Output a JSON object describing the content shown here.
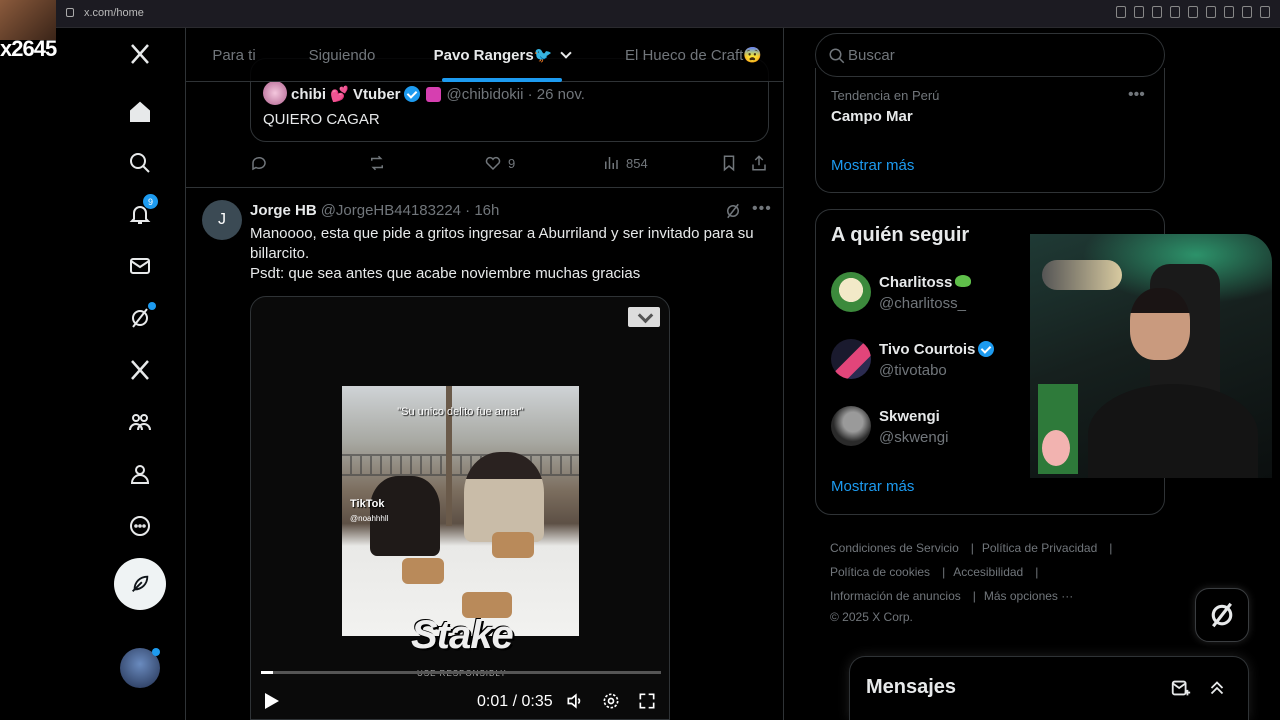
{
  "browser": {
    "url": "x.com/home"
  },
  "overlay": {
    "text": "x2645"
  },
  "nav": {
    "notification_count": "9"
  },
  "tabs": [
    {
      "label": "Para ti"
    },
    {
      "label": "Siguiendo"
    },
    {
      "label": "Pavo Rangers🐦"
    },
    {
      "label": "El Hueco de Craft😨"
    }
  ],
  "quote": {
    "name": "chibi 💕 Vtuber",
    "handle_date": "@chibidokii · 26 nov.",
    "text": "QUIERO CAGAR"
  },
  "actions": {
    "likes": "9",
    "views": "854"
  },
  "tweet": {
    "avatar_letter": "J",
    "name": "Jorge HB",
    "handle_time": "@JorgeHB44183224 · 16h",
    "text": "Manoooo, esta que pide a gritos ingresar a Aburriland y ser invitado para su billarcito.\nPsdt: que sea antes que acabe noviembre muchas gracias"
  },
  "video": {
    "caption": "\"Su unico delito fue amar\"",
    "tiktok_label": "TikTok",
    "tiktok_handle": "@noahhhll",
    "brand": "Stake",
    "brand_sub": "USE RESPONSIBLY",
    "time": "0:01 / 0:35",
    "progress": 0.03
  },
  "search": {
    "placeholder": "Buscar"
  },
  "trend": {
    "category": "Tendencia en Perú",
    "name": "Campo Mar",
    "show_more": "Mostrar más"
  },
  "who_to_follow": {
    "title": "A quién seguir",
    "accounts": [
      {
        "name": "Charlitoss",
        "handle": "@charlitoss_"
      },
      {
        "name": "Tivo Courtois",
        "handle": "@tivotabo"
      },
      {
        "name": "Skwengi",
        "handle": "@skwengi"
      }
    ],
    "show_more": "Mostrar más"
  },
  "footer": {
    "links": [
      "Condiciones de Servicio",
      "Política de Privacidad",
      "Política de cookies",
      "Accesibilidad",
      "Información de anuncios",
      "Más opciones ···"
    ],
    "copyright": "© 2025 X Corp."
  },
  "messages": {
    "title": "Mensajes"
  },
  "colors": {
    "accent": "#1d9bf0",
    "background": "#000000",
    "text": "#e7e9ea",
    "muted": "#71767b"
  }
}
